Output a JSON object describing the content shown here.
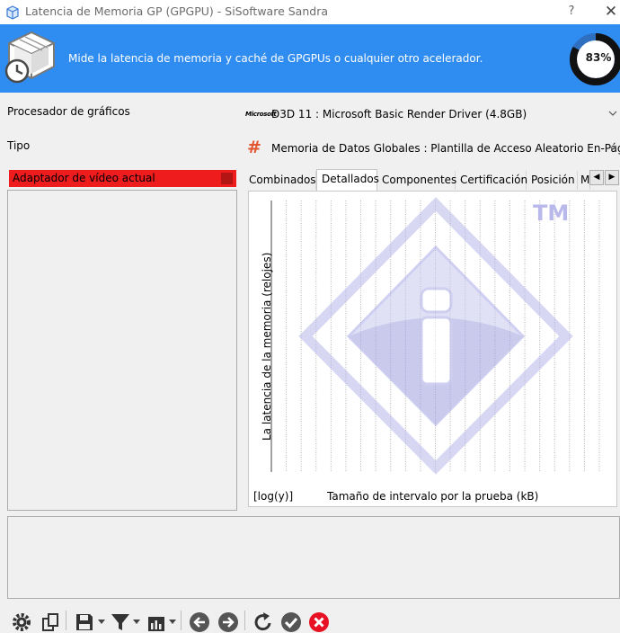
{
  "window": {
    "title": "Latencia de Memoria GP (GPGPU) - SiSoftware Sandra",
    "help_label": "?",
    "close_label": "✕"
  },
  "banner": {
    "description": "Mide la latencia de memoria y caché de GPGPUs o cualquier otro acelerador.",
    "progress_text": "83%",
    "progress_value": 83,
    "background_color": "#2f8cf0"
  },
  "form": {
    "gpu_label": "Procesador de gráficos",
    "gpu_value": "D3D 11 : Microsoft Basic Render Driver (4.8GB)",
    "gpu_logo": "Microsoft",
    "type_label": "Tipo",
    "type_value": "Memoria de Datos Globales : Plantilla de Acceso Aleatorio En-Página"
  },
  "adapter": {
    "selected_label": "Adaptador de vídeo actual",
    "highlight_color": "#ee1c1c"
  },
  "tabs": [
    {
      "label": "Combinados",
      "active": false
    },
    {
      "label": "Detallados",
      "active": true
    },
    {
      "label": "Componentes",
      "active": false
    },
    {
      "label": "Certificación",
      "active": false
    },
    {
      "label": "Posición",
      "active": false
    },
    {
      "label": "M",
      "active": false
    }
  ],
  "tab_nav": {
    "prev": "◀",
    "next": "▶"
  },
  "chart": {
    "ylabel": "La latencia de la memoria (relojes)",
    "xlabel": "Tamaño de intervalo por la prueba (kB)",
    "scale_label": "[log(y)]",
    "watermark_tm": "TM",
    "series_count": 0
  },
  "chart_data": {
    "type": "line",
    "title": "",
    "xlabel": "Tamaño de intervalo por la prueba (kB)",
    "ylabel": "La latencia de la memoria (relojes)",
    "yscale": "log",
    "grid": "vertical-dashed",
    "series": []
  },
  "toolbar": {
    "icons": [
      "gear-icon",
      "copy-icon",
      "save-icon",
      "filter-icon",
      "chart-icon",
      "back-icon",
      "forward-icon",
      "refresh-icon",
      "ok-icon",
      "cancel-icon"
    ],
    "cancel_color": "#e81123"
  }
}
